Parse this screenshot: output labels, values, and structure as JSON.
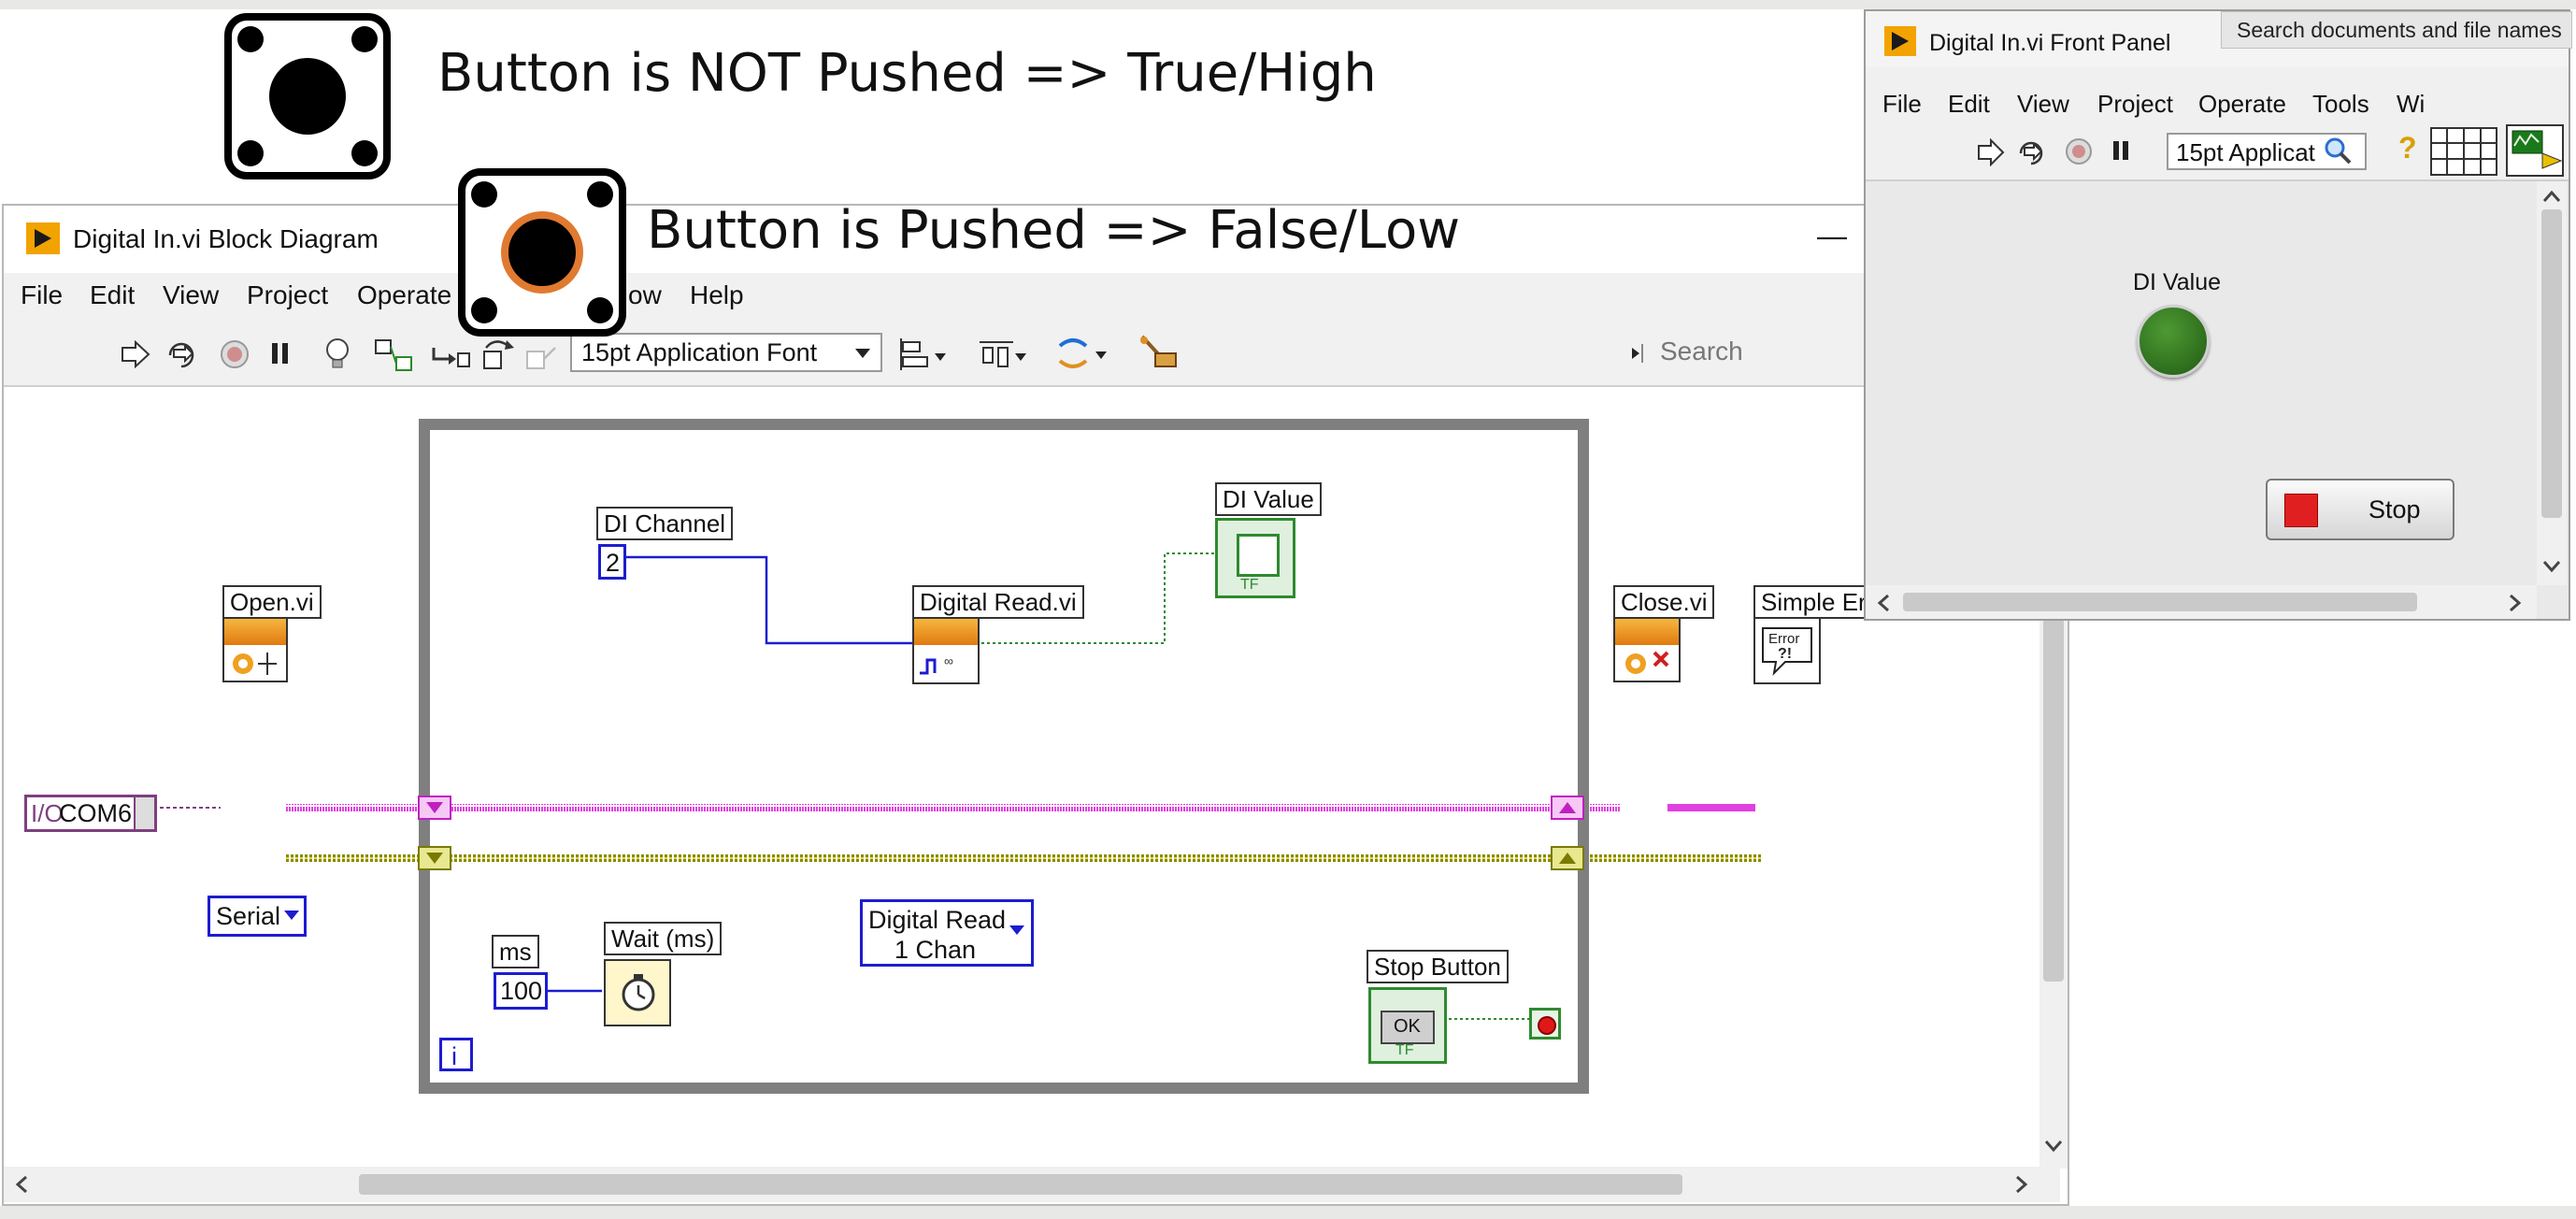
{
  "annotations": {
    "not_pushed": "Button is NOT Pushed => True/High",
    "pushed": "Button is Pushed => False/Low"
  },
  "block_diagram": {
    "title": "Digital In.vi Block Diagram",
    "minimize": "—",
    "menu": [
      "File",
      "Edit",
      "View",
      "Project",
      "Operate",
      "ow",
      "Help"
    ],
    "font": "15pt Application Font",
    "search_placeholder": "Search",
    "labels": {
      "com": "COM6",
      "open": "Open.vi",
      "serial": "Serial",
      "di_channel": "DI Channel",
      "di_channel_value": "2",
      "digital_read": "Digital Read.vi",
      "digital_read_mode_1": "Digital Read",
      "digital_read_mode_2": "1 Chan",
      "di_value": "DI Value",
      "tf": "TF",
      "close": "Close.vi",
      "simple_error": "Simple Err",
      "error_text": "Error",
      "error_marks": "?!",
      "ms": "ms",
      "wait_value": "100",
      "wait": "Wait (ms)",
      "stop_button": "Stop Button",
      "ok": "OK",
      "iteration": "i"
    },
    "colors": {
      "pink_wire": "#e040e0",
      "yellow_wire": "#8a8a00",
      "blue_wire": "#1c1cd0",
      "green_wire": "#2f8a2f",
      "loop": "#7f7f7f"
    }
  },
  "front_panel": {
    "title": "Digital In.vi Front Panel",
    "tooltip": "Search documents and file names",
    "menu": [
      "File",
      "Edit",
      "View",
      "Project",
      "Operate",
      "Tools",
      "Wi"
    ],
    "font": "15pt Applicat",
    "di_value_label": "DI Value",
    "stop_label": "Stop",
    "led_color": "#2e6e1e"
  },
  "icons": [
    "run-arrow-icon",
    "run-continuous-icon",
    "abort-icon",
    "pause-icon",
    "highlight-bulb-icon",
    "retain-wire-icon",
    "step-into-icon",
    "step-over-icon",
    "step-out-icon",
    "align-icon",
    "distribute-icon",
    "reorder-icon",
    "cleanup-icon",
    "search-icon",
    "help-icon",
    "dropdown-icon",
    "scroll-left-icon",
    "scroll-right-icon",
    "scroll-down-icon",
    "scroll-up-icon"
  ]
}
